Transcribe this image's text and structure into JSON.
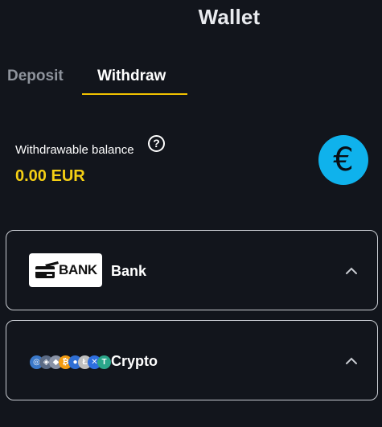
{
  "header": {
    "title": "Wallet"
  },
  "tabs": [
    {
      "label": "Deposit",
      "active": false
    },
    {
      "label": "Withdraw",
      "active": true
    }
  ],
  "balance": {
    "label": "Withdrawable balance",
    "help_icon": "question-circle-icon",
    "amount": "0.00 EUR",
    "currency_icon": "euro-icon",
    "currency_symbol": "€"
  },
  "methods": [
    {
      "label": "Bank",
      "logo_text": "BANK",
      "icon": "bank-card-icon",
      "expanded": true
    },
    {
      "label": "Crypto",
      "icon": "crypto-coins-icon",
      "expanded": true
    }
  ],
  "colors": {
    "background": "#12151c",
    "accent": "#f2c200",
    "balance": "#f5cf14",
    "currency_badge": "#0fb2ec"
  }
}
